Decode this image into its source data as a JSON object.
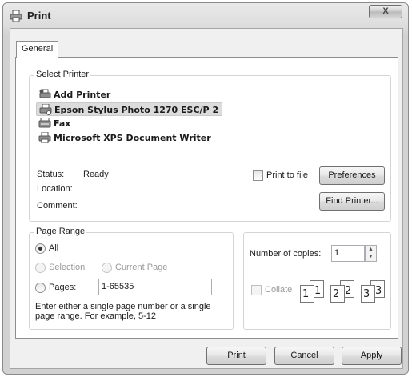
{
  "window": {
    "title": "Print",
    "close_glyph": "X",
    "title_icon": "printer-icon"
  },
  "tabs": [
    {
      "label": "General",
      "selected": true
    }
  ],
  "select_printer": {
    "label": "Select Printer",
    "items": [
      {
        "label": "Add Printer",
        "icon": "add-printer-icon",
        "selected": false
      },
      {
        "label": "Epson Stylus Photo 1270 ESC/P 2",
        "icon": "printer-icon",
        "selected": true
      },
      {
        "label": "Fax",
        "icon": "fax-icon",
        "selected": false
      },
      {
        "label": "Microsoft XPS Document Writer",
        "icon": "printer-icon",
        "selected": false
      }
    ],
    "status_label": "Status:",
    "status_value": "Ready",
    "location_label": "Location:",
    "comment_label": "Comment:",
    "print_to_file_label": "Print to file",
    "print_to_file_checked": false,
    "preferences_label": "Preferences",
    "find_printer_label": "Find Printer..."
  },
  "page_range": {
    "label": "Page Range",
    "all_label": "All",
    "selection_label": "Selection",
    "current_page_label": "Current Page",
    "pages_label": "Pages:",
    "pages_value": "1-65535",
    "selected_option": "All",
    "hint": "Enter either a single page number or a single page range.  For example, 5-12"
  },
  "copies": {
    "number_label": "Number of copies:",
    "number_value": "1",
    "collate_label": "Collate",
    "collate_checked": false,
    "collate_numbers": [
      "1",
      "1",
      "2",
      "2",
      "3",
      "3"
    ]
  },
  "footer": {
    "print_label": "Print",
    "cancel_label": "Cancel",
    "apply_label": "Apply"
  }
}
